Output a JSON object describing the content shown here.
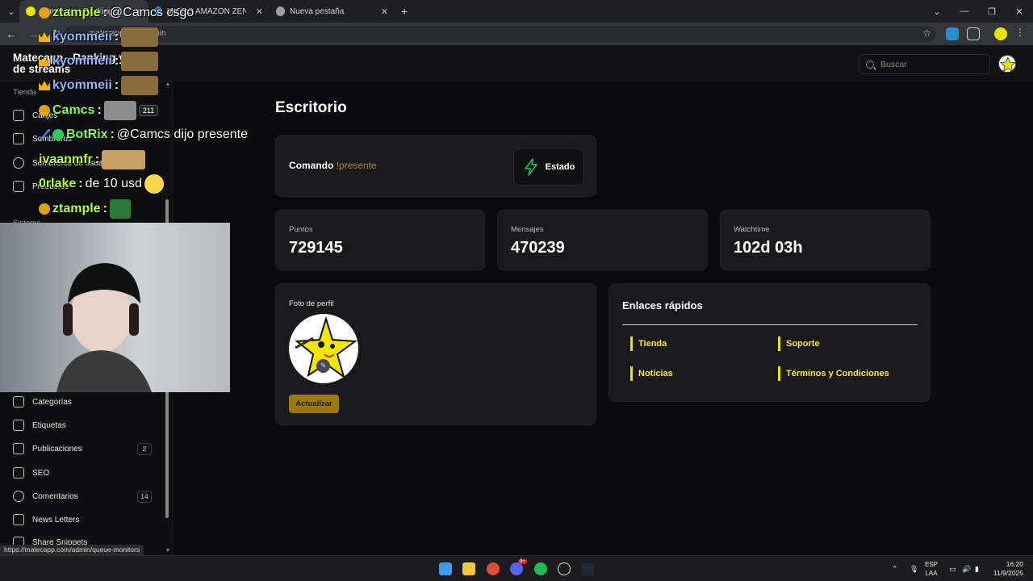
{
  "browser": {
    "tabs": [
      {
        "label": "Matecapp - Ranking y...",
        "active": true
      },
      {
        "label": "MICRO AMAZON ZEN MIX GC",
        "active": false
      },
      {
        "label": "Nueva pestaña",
        "active": false
      }
    ],
    "url": "matecapp.com/admin",
    "status_url": "https://matecapp.com/admin/queue-monitors"
  },
  "app": {
    "brand": "Matecapp - Ranking y de streams",
    "search_placeholder": "Buscar",
    "page_title": "Escritorio"
  },
  "sidebar": {
    "section_store": "Tienda",
    "section_system": "Sistema",
    "store_items": [
      {
        "label": "Canjes"
      },
      {
        "label": "Sombreros"
      },
      {
        "label": "Sombreros de usuarios"
      },
      {
        "label": "Productos"
      }
    ],
    "content_items": [
      {
        "label": "Categorías",
        "badge": ""
      },
      {
        "label": "Etiquetas",
        "badge": ""
      },
      {
        "label": "Publicaciones",
        "badge": "2"
      },
      {
        "label": "SEO",
        "badge": ""
      },
      {
        "label": "Comentarios",
        "badge": "14"
      },
      {
        "label": "News Letters",
        "badge": ""
      },
      {
        "label": "Share Snippets",
        "badge": ""
      }
    ]
  },
  "command_card": {
    "label": "Comando",
    "command": "!presente",
    "status_button": "Estado"
  },
  "stats": [
    {
      "label": "Puntos",
      "value": "729145"
    },
    {
      "label": "Mensajes",
      "value": "470239"
    },
    {
      "label": "Watchtime",
      "value": "102d 03h"
    }
  ],
  "profile": {
    "label": "Foto de perfil",
    "update_button": "Actualizar"
  },
  "quick_links": {
    "title": "Enlaces rápidos",
    "items": [
      {
        "label": "Tienda"
      },
      {
        "label": "Soporte"
      },
      {
        "label": "Noticias"
      },
      {
        "label": "Términos y Condiciones"
      }
    ]
  },
  "chat": {
    "lines": [
      {
        "user": "ztample",
        "message": "@Camcs csgo"
      },
      {
        "user": "kyommeii",
        "message": ""
      },
      {
        "user": "kyommeii",
        "message": ""
      },
      {
        "user": "kyommeii",
        "message": ""
      },
      {
        "user": "Camcs",
        "message": "",
        "badge": "211"
      },
      {
        "user": "BotRix",
        "message": "@Camcs dijo presente"
      },
      {
        "user": "ivaanmfr",
        "message": ""
      },
      {
        "user": "0rlake",
        "message": "de 10 usd"
      },
      {
        "user": "ztample",
        "message": ""
      }
    ]
  },
  "taskbar": {
    "lang_1": "ESP",
    "lang_2": "LAA",
    "time": "16:20",
    "date": "11/9/2025",
    "discord_badge": "9+"
  }
}
